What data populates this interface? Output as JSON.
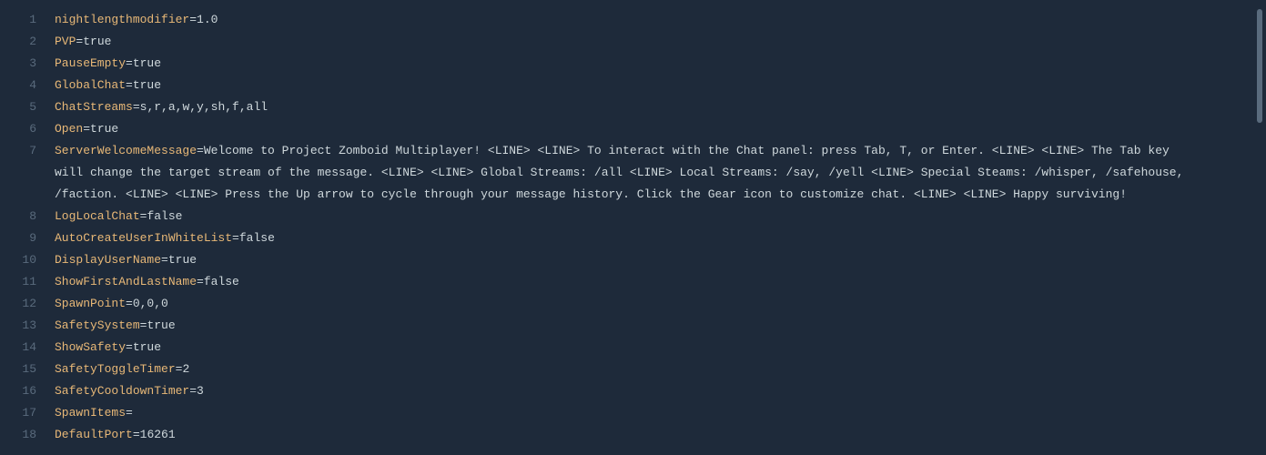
{
  "lines": [
    {
      "num": "1",
      "key": "nightlengthmodifier",
      "val": "1.0"
    },
    {
      "num": "2",
      "key": "PVP",
      "val": "true"
    },
    {
      "num": "3",
      "key": "PauseEmpty",
      "val": "true"
    },
    {
      "num": "4",
      "key": "GlobalChat",
      "val": "true"
    },
    {
      "num": "5",
      "key": "ChatStreams",
      "val": "s,r,a,w,y,sh,f,all"
    },
    {
      "num": "6",
      "key": "Open",
      "val": "true"
    },
    {
      "num": "7",
      "key": "ServerWelcomeMessage",
      "val": "Welcome to Project Zomboid Multiplayer! <LINE> <LINE> To interact with the Chat panel: press Tab, T, or Enter. <LINE> <LINE> The Tab key will change the target stream of the message. <LINE> <LINE> Global Streams: /all <LINE> Local Streams: /say, /yell <LINE> Special Steams: /whisper, /safehouse, /faction. <LINE> <LINE> Press the Up arrow to cycle through your message history. Click the Gear icon to customize chat. <LINE> <LINE> Happy surviving!"
    },
    {
      "num": "8",
      "key": "LogLocalChat",
      "val": "false"
    },
    {
      "num": "9",
      "key": "AutoCreateUserInWhiteList",
      "val": "false"
    },
    {
      "num": "10",
      "key": "DisplayUserName",
      "val": "true"
    },
    {
      "num": "11",
      "key": "ShowFirstAndLastName",
      "val": "false"
    },
    {
      "num": "12",
      "key": "SpawnPoint",
      "val": "0,0,0"
    },
    {
      "num": "13",
      "key": "SafetySystem",
      "val": "true"
    },
    {
      "num": "14",
      "key": "ShowSafety",
      "val": "true"
    },
    {
      "num": "15",
      "key": "SafetyToggleTimer",
      "val": "2"
    },
    {
      "num": "16",
      "key": "SafetyCooldownTimer",
      "val": "3"
    },
    {
      "num": "17",
      "key": "SpawnItems",
      "val": ""
    },
    {
      "num": "18",
      "key": "DefaultPort",
      "val": "16261"
    }
  ]
}
